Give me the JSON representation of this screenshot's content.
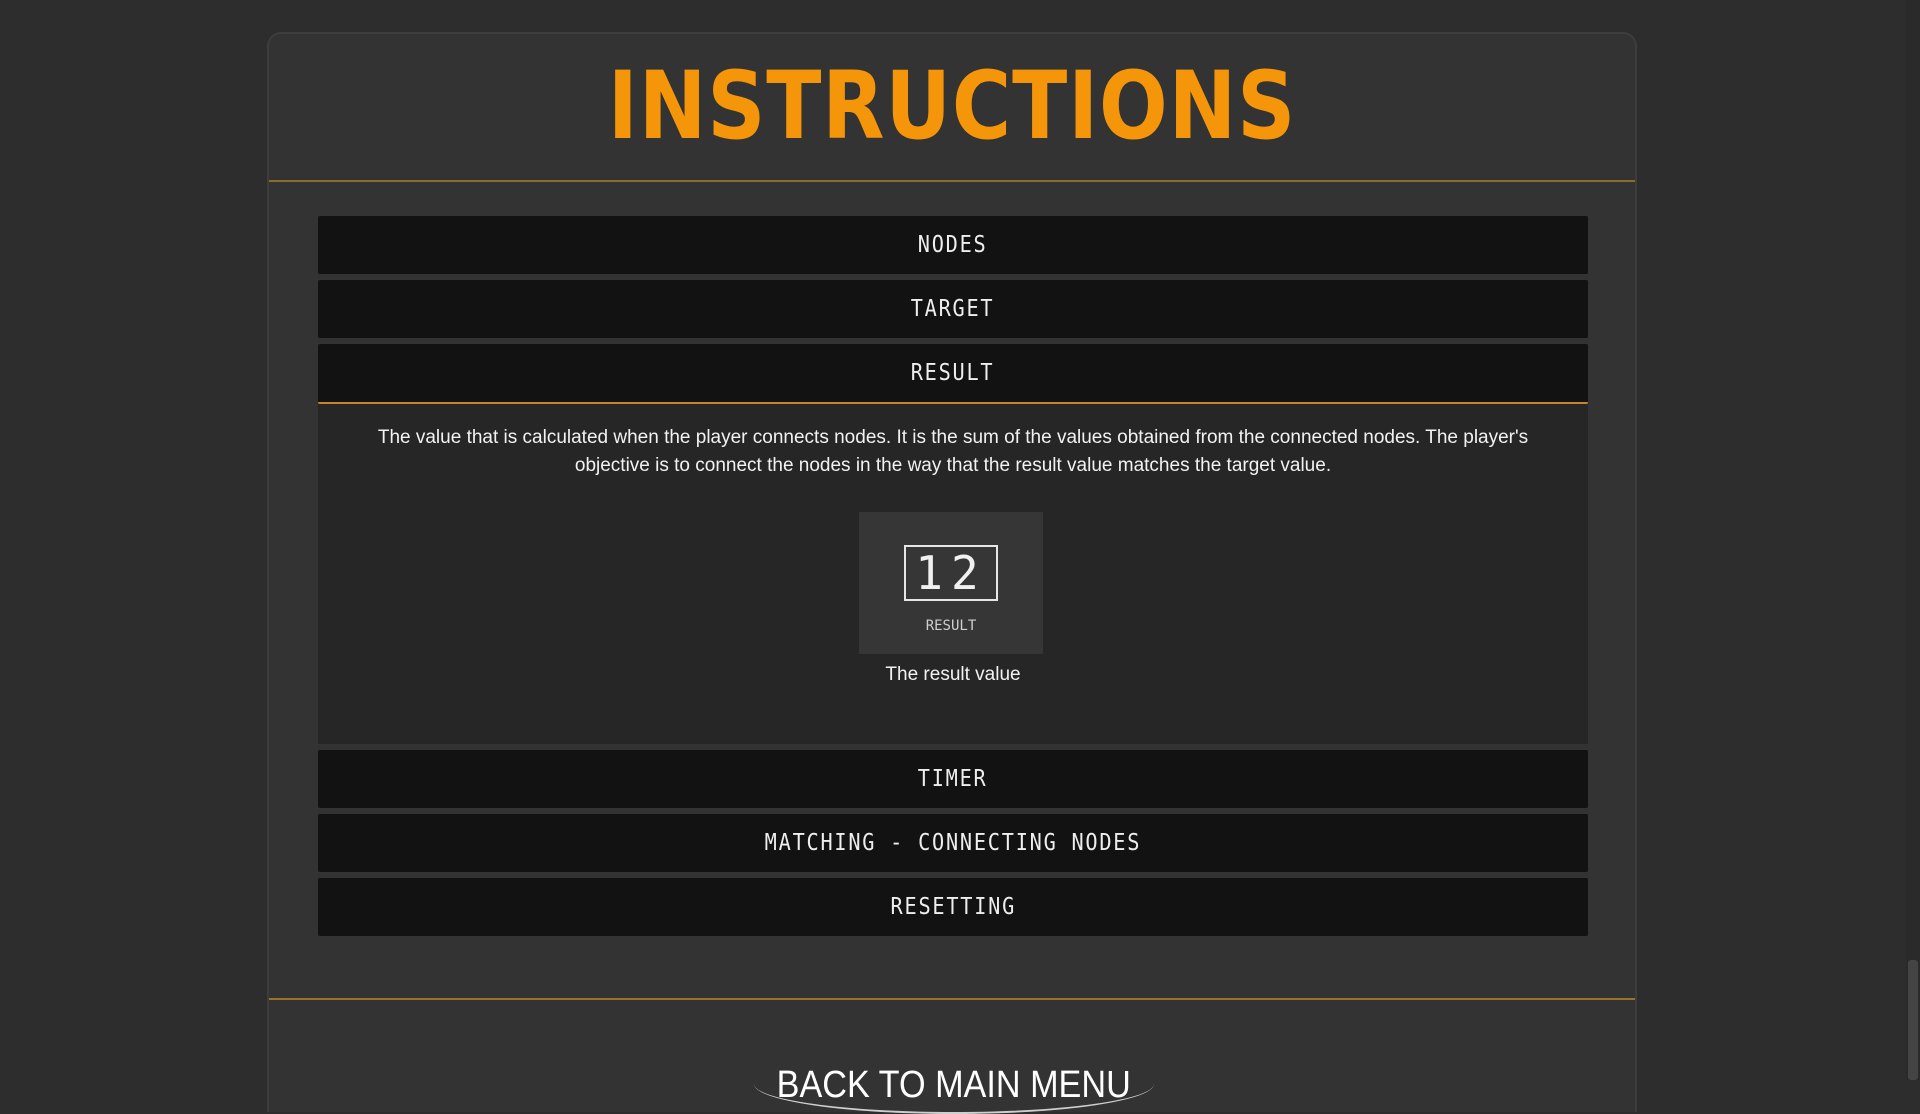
{
  "title": "INSTRUCTIONS",
  "sections": [
    {
      "label": "NODES"
    },
    {
      "label": "TARGET"
    },
    {
      "label": "RESULT",
      "open": true,
      "body": "The value that is calculated when the player connects nodes. It is the sum of the values obtained from the connected nodes. The player's objective is to connect the nodes in the way that the result value matches the target value.",
      "demo_value": "12",
      "demo_label": "RESULT",
      "caption": "The result value"
    },
    {
      "label": "TIMER"
    },
    {
      "label": "MATCHING - CONNECTING NODES"
    },
    {
      "label": "RESETTING"
    }
  ],
  "back_button": "BACK TO MAIN MENU",
  "colors": {
    "accent": "#f5960a",
    "background": "#2d2d2d",
    "panel": "#333333"
  }
}
